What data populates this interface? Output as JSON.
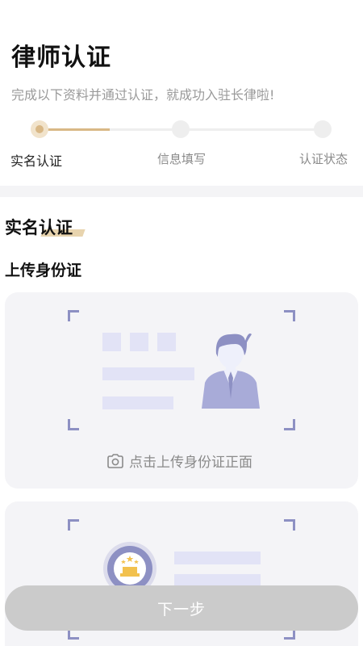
{
  "header": {
    "title": "律师认证",
    "subtitle": "完成以下资料并通过认证，就成功入驻长律啦!"
  },
  "steps": [
    {
      "label": "实名认证",
      "active": true
    },
    {
      "label": "信息填写",
      "active": false
    },
    {
      "label": "认证状态",
      "active": false
    }
  ],
  "section": {
    "title": "实名认证",
    "upload_heading": "上传身份证"
  },
  "id_front_card": {
    "caption": "点击上传身份证正面",
    "icon": "camera-icon"
  },
  "id_back_card": {
    "icon": "emblem-icon"
  },
  "footer": {
    "next_label": "下一步"
  },
  "colors": {
    "accent": "#d9b886",
    "illustration": "#8d90c3",
    "button_disabled": "#cbcbcb"
  }
}
